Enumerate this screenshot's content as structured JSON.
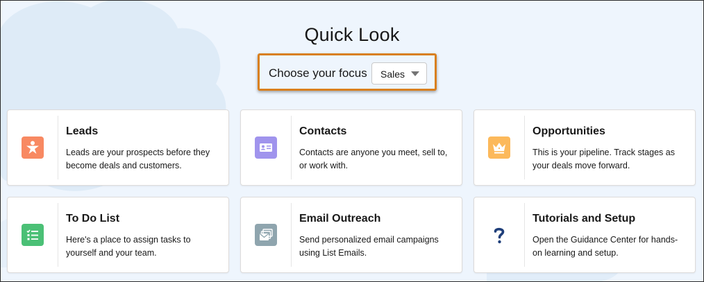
{
  "page": {
    "title": "Quick Look"
  },
  "focus": {
    "label": "Choose your focus",
    "selected": "Sales",
    "accent_border": "#d9801f"
  },
  "cards": [
    {
      "title": "Leads",
      "description": "Leads are your prospects before they become deals and customers.",
      "icon": "leads-icon",
      "icon_color": "#f88962"
    },
    {
      "title": "Contacts",
      "description": "Contacts are anyone you meet, sell to, or work with.",
      "icon": "contacts-icon",
      "icon_color": "#a094ed"
    },
    {
      "title": "Opportunities",
      "description": "This is your pipeline. Track stages as your deals move forward.",
      "icon": "opportunities-icon",
      "icon_color": "#fcb95b"
    },
    {
      "title": "To Do List",
      "description": "Here's a place to assign tasks to yourself and your team.",
      "icon": "todo-list-icon",
      "icon_color": "#4bc076"
    },
    {
      "title": "Email Outreach",
      "description": "Send personalized email campaigns using List Emails.",
      "icon": "email-outreach-icon",
      "icon_color": "#8fa5ae"
    },
    {
      "title": "Tutorials and Setup",
      "description": "Open the Guidance Center for hands-on learning and setup.",
      "icon": "question-mark-icon",
      "icon_color": "#1f3f7a"
    }
  ]
}
